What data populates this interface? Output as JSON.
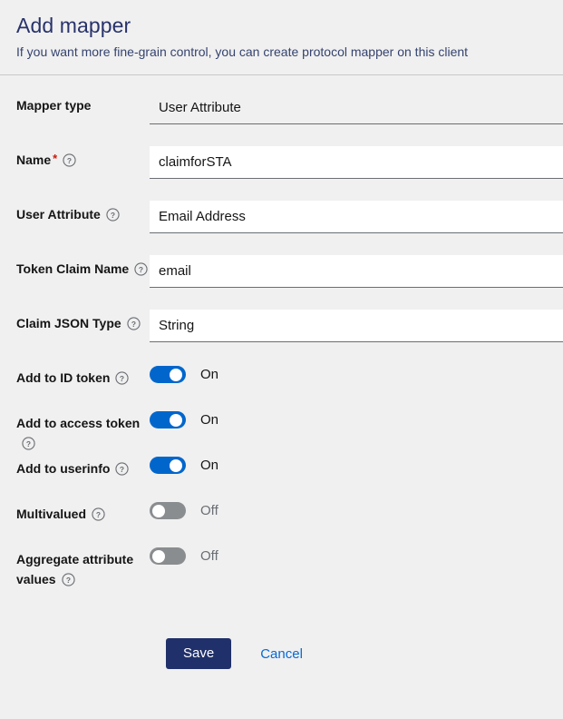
{
  "header": {
    "title": "Add mapper",
    "subtitle": "If you want more fine-grain control, you can create protocol mapper on this client"
  },
  "form": {
    "fields": [
      {
        "label": "Mapper type",
        "value": "User Attribute",
        "required": false,
        "help": false,
        "kind": "readonly",
        "name": "mapper-type"
      },
      {
        "label": "Name",
        "value": "claimforSTA",
        "required": true,
        "help": true,
        "kind": "text",
        "name": "name"
      },
      {
        "label": "User Attribute",
        "value": "Email Address",
        "required": false,
        "help": true,
        "kind": "text",
        "name": "user-attribute"
      },
      {
        "label": "Token Claim Name",
        "value": "email",
        "required": false,
        "help": true,
        "kind": "text",
        "name": "token-claim-name"
      },
      {
        "label": "Claim JSON Type",
        "value": "String",
        "required": false,
        "help": true,
        "kind": "text",
        "name": "claim-json-type"
      }
    ],
    "toggles": [
      {
        "label": "Add to ID token",
        "state": "On",
        "on": true,
        "name": "add-to-id-token"
      },
      {
        "label": "Add to access token",
        "state": "On",
        "on": true,
        "name": "add-to-access-token"
      },
      {
        "label": "Add to userinfo",
        "state": "On",
        "on": true,
        "name": "add-to-userinfo"
      },
      {
        "label": "Multivalued",
        "state": "Off",
        "on": false,
        "name": "multivalued"
      },
      {
        "label": "Aggregate attribute values",
        "state": "Off",
        "on": false,
        "name": "aggregate-attribute-values"
      }
    ]
  },
  "actions": {
    "save_label": "Save",
    "cancel_label": "Cancel"
  },
  "icons": {
    "help": "help-circle-icon"
  },
  "colors": {
    "title": "#28336b",
    "toggle_on": "#0066cc",
    "toggle_off": "#8a8d90",
    "save_bg": "#20306a",
    "link": "#0869d3",
    "required_star": "#c9190b",
    "page_bg": "#f0f0f0"
  }
}
